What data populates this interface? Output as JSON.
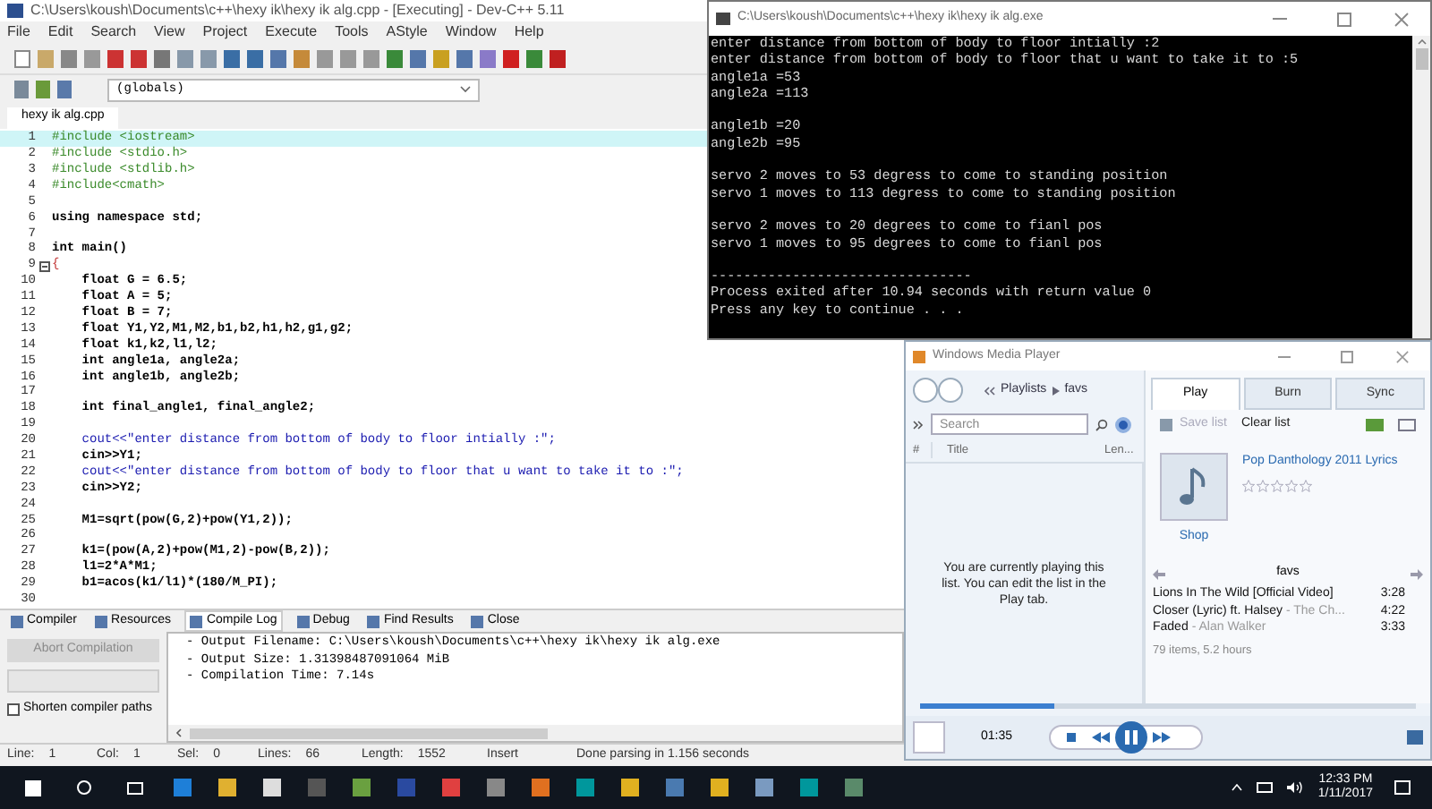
{
  "devcpp": {
    "title": "C:\\Users\\koush\\Documents\\c++\\hexy ik\\hexy ik alg.cpp - [Executing] - Dev-C++ 5.11",
    "menu": [
      "File",
      "Edit",
      "Search",
      "View",
      "Project",
      "Execute",
      "Tools",
      "AStyle",
      "Window",
      "Help"
    ],
    "scope": "(globals)",
    "file_tabs": [
      {
        "label": "hexy ik alg.cpp",
        "selected": true
      }
    ],
    "code": [
      {
        "n": "1",
        "text": "#include <iostream>",
        "kind": "directive",
        "current": true
      },
      {
        "n": "2",
        "text": "#include <stdio.h>",
        "kind": "directive",
        "current": false
      },
      {
        "n": "3",
        "text": "#include <stdlib.h>",
        "kind": "directive",
        "current": false
      },
      {
        "n": "4",
        "text": "#include<cmath>",
        "kind": "directive",
        "current": false
      },
      {
        "n": "5",
        "kind": "blank",
        "current": false
      },
      {
        "n": "6",
        "text": "using namespace std;",
        "kind": "code",
        "current": false
      },
      {
        "n": "7",
        "kind": "blank",
        "current": false
      },
      {
        "n": "8",
        "text": "int main()",
        "kind": "code",
        "current": false
      },
      {
        "n": "9",
        "text": "{",
        "kind": "fold",
        "current": false
      },
      {
        "n": "10",
        "text": "    float G = 6.5;",
        "kind": "code",
        "current": false
      },
      {
        "n": "11",
        "text": "    float A = 5;",
        "kind": "code",
        "current": false
      },
      {
        "n": "12",
        "text": "    float B = 7;",
        "kind": "code",
        "current": false
      },
      {
        "n": "13",
        "text": "    float Y1,Y2,M1,M2,b1,b2,h1,h2,g1,g2;",
        "kind": "code",
        "current": false
      },
      {
        "n": "14",
        "text": "    float k1,k2,l1,l2;",
        "kind": "code",
        "current": false
      },
      {
        "n": "15",
        "text": "    int angle1a, angle2a;",
        "kind": "code",
        "current": false
      },
      {
        "n": "16",
        "text": "    int angle1b, angle2b;",
        "kind": "code",
        "current": false
      },
      {
        "n": "17",
        "kind": "blank",
        "current": false
      },
      {
        "n": "18",
        "text": "    int final_angle1, final_angle2;",
        "kind": "code",
        "current": false
      },
      {
        "n": "19",
        "kind": "blank",
        "current": false
      },
      {
        "n": "20",
        "text": "    cout<<\"enter distance from bottom of body to floor intially :\";",
        "kind": "string",
        "current": false
      },
      {
        "n": "21",
        "text": "    cin>>Y1;",
        "kind": "code",
        "current": false
      },
      {
        "n": "22",
        "text": "    cout<<\"enter distance from bottom of body to floor that u want to take it to :\";",
        "kind": "string",
        "current": false
      },
      {
        "n": "23",
        "text": "    cin>>Y2;",
        "kind": "code",
        "current": false
      },
      {
        "n": "24",
        "kind": "blank",
        "current": false
      },
      {
        "n": "25",
        "text": "    M1=sqrt(pow(G,2)+pow(Y1,2));",
        "kind": "code",
        "current": false
      },
      {
        "n": "26",
        "kind": "blank",
        "current": false
      },
      {
        "n": "27",
        "text": "    k1=(pow(A,2)+pow(M1,2)-pow(B,2));",
        "kind": "code",
        "current": false
      },
      {
        "n": "28",
        "text": "    l1=2*A*M1;",
        "kind": "code",
        "current": false
      },
      {
        "n": "29",
        "text": "    b1=acos(k1/l1)*(180/M_PI);",
        "kind": "code",
        "current": false
      },
      {
        "n": "30",
        "kind": "blank",
        "current": false
      }
    ],
    "panel_tabs": [
      {
        "label": "Compiler",
        "selected": false
      },
      {
        "label": "Resources",
        "selected": false
      },
      {
        "label": "Compile Log",
        "selected": true
      },
      {
        "label": "Debug",
        "selected": false
      },
      {
        "label": "Find Results",
        "selected": false
      },
      {
        "label": "Close",
        "selected": false
      }
    ],
    "abort_button": {
      "label": "Abort Compilation",
      "disabled": true
    },
    "shorten_paths": {
      "label": "Shorten compiler paths",
      "checked": false
    },
    "log": [
      "- Output Filename: C:\\Users\\koush\\Documents\\c++\\hexy ik\\hexy ik alg.exe",
      "- Output Size: 1.31398487091064 MiB",
      "- Compilation Time: 7.14s"
    ],
    "status_bar": [
      {
        "label": "Line:",
        "value": "1"
      },
      {
        "label": "Col:",
        "value": "1"
      },
      {
        "label": "Sel:",
        "value": "0"
      },
      {
        "label": "Lines:",
        "value": "66"
      },
      {
        "label": "Length:",
        "value": "1552"
      },
      {
        "value": "Insert"
      },
      {
        "value": "Done parsing in 1.156 seconds"
      }
    ]
  },
  "console": {
    "title": "C:\\Users\\koush\\Documents\\c++\\hexy ik\\hexy ik alg.exe",
    "blocks": [
      [
        "enter distance from bottom of body to floor intially :2",
        "enter distance from bottom of body to floor that u want to take it to :5",
        "angle1a =53",
        "angle2a =113"
      ],
      [
        "angle1b =20",
        "angle2b =95"
      ],
      [
        "servo 2 moves to 53 degress to come to standing position",
        "servo 1 moves to 113 degress to come to standing position"
      ],
      [
        "servo 2 moves to 20 degrees to come to fianl pos",
        "servo 1 moves to 95 degrees to come to fianl pos"
      ],
      [
        "--------------------------------",
        "Process exited after 10.94 seconds with return value 0",
        "Press any key to continue . . ."
      ]
    ]
  },
  "media_player": {
    "title": "Windows Media Player",
    "breadcrumb": [
      "Playlists",
      "favs"
    ],
    "tabs": [
      {
        "label": "Play",
        "selected": true
      },
      {
        "label": "Burn",
        "selected": false
      },
      {
        "label": "Sync",
        "selected": false
      }
    ],
    "search": {
      "placeholder": "Search"
    },
    "save_list": {
      "label": "Save list",
      "disabled": true
    },
    "clear_list": {
      "label": "Clear list",
      "disabled": false
    },
    "columns": [
      "#",
      "Title",
      "Len..."
    ],
    "message": "You are currently playing this list.  You can edit the list in the Play tab.",
    "album": {
      "title": "Pop Danthology 2011 Lyrics",
      "stars": 0,
      "shop": "Shop"
    },
    "playlist_name": "favs",
    "tracks": [
      {
        "title": "Lions In The Wild [Official Video]",
        "length": "3:28"
      },
      {
        "title": "Closer (Lyric) ft. Halsey",
        "artist": "- The Ch...",
        "length": "4:22"
      },
      {
        "title": "Faded",
        "artist": "- Alan Walker",
        "length": "3:33"
      }
    ],
    "summary": "79 items, 5.2 hours",
    "time": "01:35",
    "progress": {
      "level": 0.27
    }
  },
  "taskbar": {
    "time": "12:33 PM",
    "date": "1/11/2017"
  }
}
